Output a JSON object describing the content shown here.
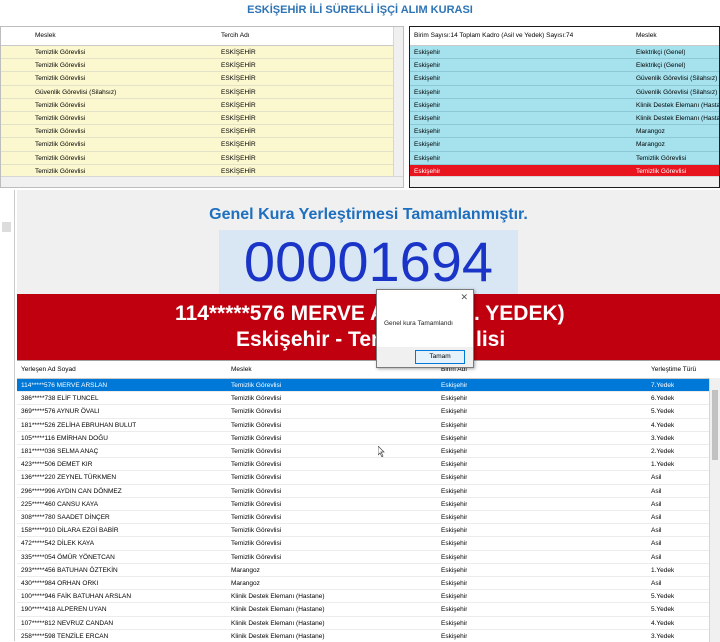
{
  "title": "ESKİŞEHİR İLİ SÜREKLİ İŞÇİ ALIM KURASI",
  "top_left": {
    "headers": [
      "Meslek",
      "Tercih Adı"
    ],
    "rows": [
      [
        "Temizlik Görevlisi",
        "ESKİŞEHİR"
      ],
      [
        "Temizlik Görevlisi",
        "ESKİŞEHİR"
      ],
      [
        "Temizlik Görevlisi",
        "ESKİŞEHİR"
      ],
      [
        "Güvenlik Görevlisi (Silahsız)",
        "ESKİŞEHİR"
      ],
      [
        "Temizlik Görevlisi",
        "ESKİŞEHİR"
      ],
      [
        "Temizlik Görevlisi",
        "ESKİŞEHİR"
      ],
      [
        "Temizlik Görevlisi",
        "ESKİŞEHİR"
      ],
      [
        "Temizlik Görevlisi",
        "ESKİŞEHİR"
      ],
      [
        "Temizlik Görevlisi",
        "ESKİŞEHİR"
      ],
      [
        "Temizlik Görevlisi",
        "ESKİŞEHİR"
      ]
    ]
  },
  "top_right": {
    "headers": [
      "Birim Sayısı:14 Toplam Kadro (Asil ve Yedek) Sayısı:74",
      "Meslek"
    ],
    "rows": [
      [
        "Eskişehir",
        "Elektrikçi (Genel)"
      ],
      [
        "Eskişehir",
        "Elektrikçi (Genel)"
      ],
      [
        "Eskişehir",
        "Güvenlik Görevlisi (Silahsız)"
      ],
      [
        "Eskişehir",
        "Güvenlik Görevlisi (Silahsız)"
      ],
      [
        "Eskişehir",
        "Klinik Destek Elemanı (Hastane)"
      ],
      [
        "Eskişehir",
        "Klinik Destek Elemanı (Hastane)"
      ],
      [
        "Eskişehir",
        "Marangoz"
      ],
      [
        "Eskişehir",
        "Marangoz"
      ],
      [
        "Eskişehir",
        "Temizlik Görevlisi"
      ],
      [
        "Eskişehir",
        "Temizlik Görevlisi"
      ]
    ],
    "highlight_color": "#e8141e"
  },
  "result": {
    "heading": "Genel Kura Yerleştirmesi Tamamlanmıştır.",
    "number": "00001694",
    "winner_line1": "114*****576 MERVE A",
    "winner_line1_tail": ". YEDEK)",
    "winner_line2": "Eskişehir - Tem",
    "winner_line2_tail": "lisi",
    "banner_color": "#c0000e"
  },
  "dialog": {
    "message": "Genel kura Tamamlandı",
    "ok_label": "Tamam",
    "close_glyph": "✕"
  },
  "bottom": {
    "headers": [
      "Yerleşen Ad Soyad",
      "Meslek",
      "Birim Adı",
      "Yerleştime Türü"
    ],
    "rows": [
      [
        "114*****576 MERVE ARSLAN",
        "Temizlik Görevlisi",
        "Eskişehir",
        "7.Yedek"
      ],
      [
        "386*****738 ELİF TUNCEL",
        "Temizlik Görevlisi",
        "Eskişehir",
        "6.Yedek"
      ],
      [
        "369*****576 AYNUR ÖVALI",
        "Temizlik Görevlisi",
        "Eskişehir",
        "5.Yedek"
      ],
      [
        "181*****526 ZELİHA EBRUHAN BULUT",
        "Temizlik Görevlisi",
        "Eskişehir",
        "4.Yedek"
      ],
      [
        "105*****116 EMİRHAN DOĞU",
        "Temizlik Görevlisi",
        "Eskişehir",
        "3.Yedek"
      ],
      [
        "181*****036 SELMA ANAÇ",
        "Temizlik Görevlisi",
        "Eskişehir",
        "2.Yedek"
      ],
      [
        "423*****506 DEMET KIR",
        "Temizlik Görevlisi",
        "Eskişehir",
        "1.Yedek"
      ],
      [
        "136*****220 ZEYNEL TÜRKMEN",
        "Temizlik Görevlisi",
        "Eskişehir",
        "Asil"
      ],
      [
        "296*****996 AYDIN CAN DÖNMEZ",
        "Temizlik Görevlisi",
        "Eskişehir",
        "Asil"
      ],
      [
        "225*****460 CANSU KAYA",
        "Temizlik Görevlisi",
        "Eskişehir",
        "Asil"
      ],
      [
        "308*****780 SAADET DİNÇER",
        "Temizlik Görevlisi",
        "Eskişehir",
        "Asil"
      ],
      [
        "158*****910 DİLARA EZGİ BABİR",
        "Temizlik Görevlisi",
        "Eskişehir",
        "Asil"
      ],
      [
        "472*****542 DİLEK KAYA",
        "Temizlik Görevlisi",
        "Eskişehir",
        "Asil"
      ],
      [
        "335*****054 ÖMÜR YÖNETCAN",
        "Temizlik Görevlisi",
        "Eskişehir",
        "Asil"
      ],
      [
        "293*****456 BATUHAN ÖZTEKİN",
        "Marangoz",
        "Eskişehir",
        "1.Yedek"
      ],
      [
        "430*****984 ORHAN ORKI",
        "Marangoz",
        "Eskişehir",
        "Asil"
      ],
      [
        "100*****946 FAİK BATUHAN ARSLAN",
        "Klinik Destek Elemanı (Hastane)",
        "Eskişehir",
        "5.Yedek"
      ],
      [
        "190*****418 ALPEREN UYAN",
        "Klinik Destek Elemanı (Hastane)",
        "Eskişehir",
        "5.Yedek"
      ],
      [
        "107*****812 NEVRUZ CANDAN",
        "Klinik Destek Elemanı (Hastane)",
        "Eskişehir",
        "4.Yedek"
      ],
      [
        "258*****598 TENZİLE ERCAN",
        "Klinik Destek Elemanı (Hastane)",
        "Eskişehir",
        "3.Yedek"
      ]
    ],
    "selected_color": "#0078d7"
  }
}
